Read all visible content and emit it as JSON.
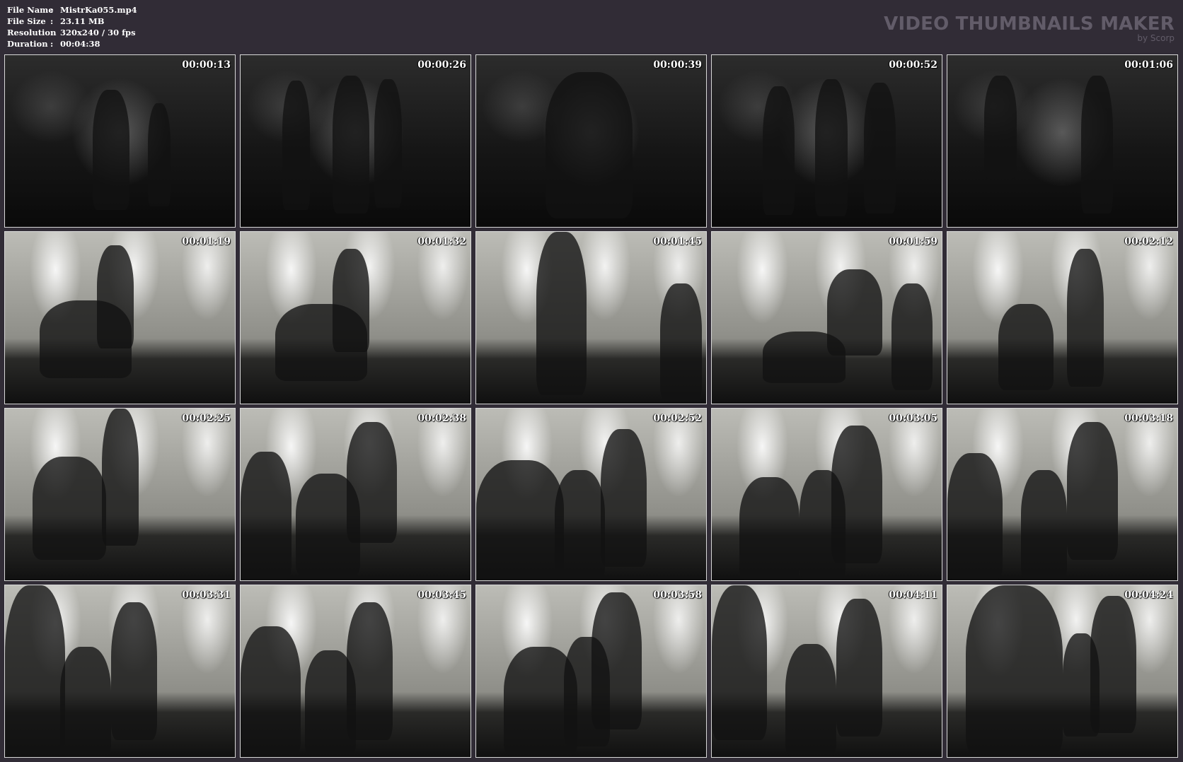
{
  "file_info": {
    "rows": [
      {
        "label": "File Name",
        "sep": ":",
        "value": "MistrKa055.mp4"
      },
      {
        "label": "File Size",
        "sep": ":",
        "value": "23.11 MB"
      },
      {
        "label": "Resolution",
        "sep": ":",
        "value": "320x240 / 30 fps"
      },
      {
        "label": "Duration",
        "sep": ":",
        "value": "00:04:38"
      }
    ]
  },
  "brand": {
    "title": "VIDEO THUMBNAILS MAKER",
    "subtitle": "by Scorp"
  },
  "thumbnails": [
    {
      "timestamp": "00:00:13",
      "tone": "dark"
    },
    {
      "timestamp": "00:00:26",
      "tone": "dark"
    },
    {
      "timestamp": "00:00:39",
      "tone": "dark"
    },
    {
      "timestamp": "00:00:52",
      "tone": "dark"
    },
    {
      "timestamp": "00:01:06",
      "tone": "dark"
    },
    {
      "timestamp": "00:01:19",
      "tone": "light"
    },
    {
      "timestamp": "00:01:32",
      "tone": "light"
    },
    {
      "timestamp": "00:01:45",
      "tone": "light"
    },
    {
      "timestamp": "00:01:59",
      "tone": "light"
    },
    {
      "timestamp": "00:02:12",
      "tone": "light"
    },
    {
      "timestamp": "00:02:25",
      "tone": "light"
    },
    {
      "timestamp": "00:02:38",
      "tone": "light"
    },
    {
      "timestamp": "00:02:52",
      "tone": "light"
    },
    {
      "timestamp": "00:03:05",
      "tone": "light"
    },
    {
      "timestamp": "00:03:18",
      "tone": "light"
    },
    {
      "timestamp": "00:03:31",
      "tone": "light"
    },
    {
      "timestamp": "00:03:45",
      "tone": "light"
    },
    {
      "timestamp": "00:03:58",
      "tone": "light"
    },
    {
      "timestamp": "00:04:11",
      "tone": "light"
    },
    {
      "timestamp": "00:04:24",
      "tone": "light"
    }
  ],
  "colors": {
    "background": "#312c36",
    "brand_text": "#625c69",
    "thumb_border": "#d8d8d8",
    "text": "#ffffff"
  }
}
